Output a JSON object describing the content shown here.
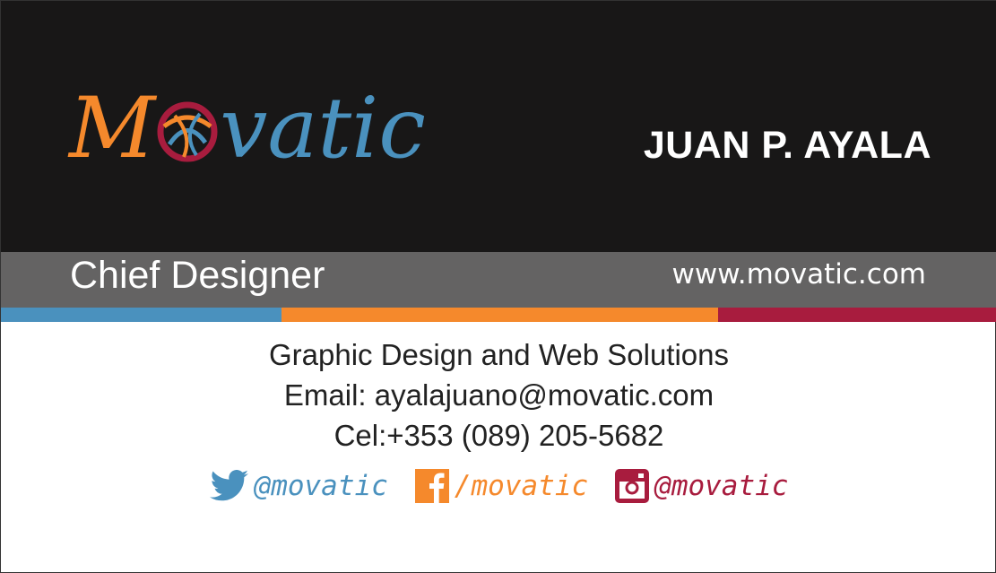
{
  "brand": {
    "logo_text_first": "M",
    "logo_text_rest": "vatic",
    "colors": {
      "orange": "#f5892c",
      "blue": "#4a91be",
      "red": "#a81c3e",
      "dark": "#181717",
      "gray": "#646363"
    }
  },
  "person": {
    "name": "JUAN P. AYALA",
    "title": "Chief Designer"
  },
  "website": "www.movatic.com",
  "stripes": [
    {
      "color": "#4a91be",
      "weight": 313
    },
    {
      "color": "#f5892c",
      "weight": 487
    },
    {
      "color": "#a81c3e",
      "weight": 311
    }
  ],
  "details": {
    "tagline": "Graphic Design and Web Solutions",
    "email": "Email: ayalajuano@movatic.com",
    "phone": "Cel:+353 (089) 205-5682"
  },
  "social": {
    "twitter": {
      "icon": "twitter-bird-icon",
      "handle": "@movatic"
    },
    "facebook": {
      "icon": "facebook-icon",
      "handle": "/movatic"
    },
    "instagram": {
      "icon": "instagram-icon",
      "handle": "@movatic"
    }
  }
}
